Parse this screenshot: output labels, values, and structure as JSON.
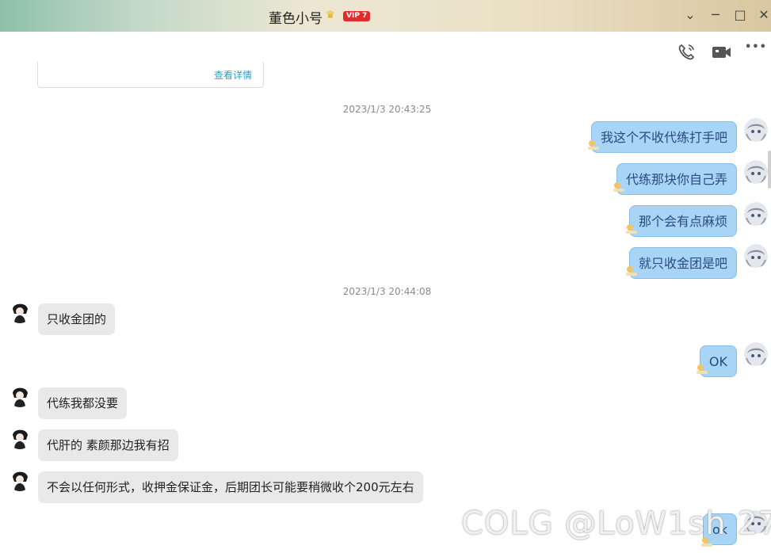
{
  "window": {
    "title": "董色小号",
    "vip_label": "VIP 7",
    "crown_glyph": "♛",
    "minimize_glyph": "─",
    "maximize_glyph": "□",
    "close_glyph": "✕",
    "collapse_glyph": "⌄"
  },
  "toolbar": {
    "more_glyph": "•••"
  },
  "card": {
    "link_label": "查看详情"
  },
  "timestamps": [
    "2023/1/3 20:43:25",
    "2023/1/3 20:44:08"
  ],
  "messages": [
    {
      "side": "right",
      "text": "我这个不收代练打手吧"
    },
    {
      "side": "right",
      "text": "代练那块你自己弄"
    },
    {
      "side": "right",
      "text": "那个会有点麻烦"
    },
    {
      "side": "right",
      "text": "就只收金团是吧"
    },
    {
      "side": "left",
      "text": "只收金团的"
    },
    {
      "side": "right",
      "text": "OK"
    },
    {
      "side": "left",
      "text": "代练我都没要"
    },
    {
      "side": "left",
      "text": "代肝的 素颜那边我有招"
    },
    {
      "side": "left",
      "text": "不会以任何形式，收押金保证金，后期团长可能要稍微收个200元左右"
    },
    {
      "side": "right",
      "text": "ok"
    }
  ],
  "watermark": "COLG @LoW1sh 27",
  "colors": {
    "self_bubble": "#a8d4f6",
    "other_bubble": "#e9e9e9",
    "link": "#27a3c6",
    "vip_badge": "#e22b2b"
  }
}
